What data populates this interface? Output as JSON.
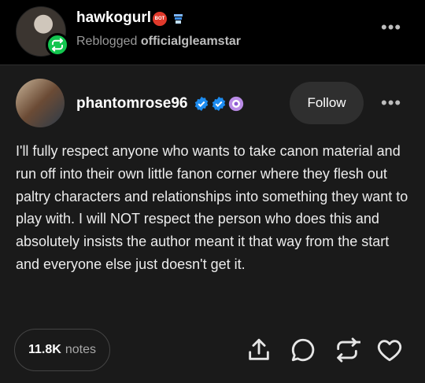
{
  "reblog": {
    "username": "hawkogurl",
    "reblogged_prefix": "Reblogged",
    "source_username": "officialgleamstar",
    "badge_red_text": "BOT"
  },
  "post": {
    "author": "phantomrose96",
    "follow_label": "Follow",
    "body": "I'll fully respect anyone who wants to take canon material and run off into their own little fanon corner where they flesh out paltry characters and relationships into something they want to play with. I will NOT respect the person who does this and absolutely insists the author meant it that way from the start and everyone else just doesn't get it."
  },
  "footer": {
    "notes_count": "11.8K",
    "notes_label": "notes"
  },
  "icons": {
    "reblog_badge": "reblog-icon",
    "share": "share-icon",
    "reply": "reply-icon",
    "reblog": "reblog-icon",
    "like": "heart-icon",
    "more": "more-dots-icon"
  },
  "colors": {
    "reblog_green": "#13c54f",
    "verified_blue": "#1d8cf0",
    "background": "#1a1a1a"
  }
}
